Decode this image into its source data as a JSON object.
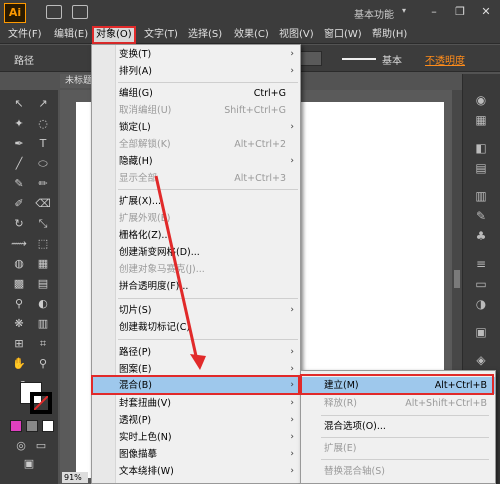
{
  "app": {
    "logo": "Ai",
    "workspace": "基本功能",
    "workspace_arrow": "▾"
  },
  "window_controls": {
    "minimize": "–",
    "restore": "❐",
    "close": "✕"
  },
  "menubar": [
    {
      "label": "文件(F)"
    },
    {
      "label": "编辑(E)"
    },
    {
      "label": "对象(O)"
    },
    {
      "label": "文字(T)"
    },
    {
      "label": "选择(S)"
    },
    {
      "label": "效果(C)"
    },
    {
      "label": "视图(V)"
    },
    {
      "label": "窗口(W)"
    },
    {
      "label": "帮助(H)"
    }
  ],
  "controlbar": {
    "path_label": "路径",
    "stroke_style": "基本",
    "opacity_link": "不透明度"
  },
  "document": {
    "tab_title": "未标题",
    "zoom": "91%"
  },
  "object_menu": {
    "items": [
      {
        "label": "变换(T)",
        "shortcut": "",
        "submenu": true,
        "disabled": false
      },
      {
        "label": "排列(A)",
        "shortcut": "",
        "submenu": true,
        "disabled": false
      },
      {
        "label": "编组(G)",
        "shortcut": "Ctrl+G",
        "submenu": false,
        "disabled": false
      },
      {
        "label": "取消编组(U)",
        "shortcut": "Shift+Ctrl+G",
        "submenu": false,
        "disabled": true
      },
      {
        "label": "锁定(L)",
        "shortcut": "",
        "submenu": true,
        "disabled": false
      },
      {
        "label": "全部解锁(K)",
        "shortcut": "Alt+Ctrl+2",
        "submenu": false,
        "disabled": true
      },
      {
        "label": "隐藏(H)",
        "shortcut": "",
        "submenu": true,
        "disabled": false
      },
      {
        "label": "显示全部",
        "shortcut": "Alt+Ctrl+3",
        "submenu": false,
        "disabled": true
      },
      {
        "label": "扩展(X)...",
        "shortcut": "",
        "submenu": false,
        "disabled": false
      },
      {
        "label": "扩展外观(E)",
        "shortcut": "",
        "submenu": false,
        "disabled": true
      },
      {
        "label": "栅格化(Z)...",
        "shortcut": "",
        "submenu": false,
        "disabled": false
      },
      {
        "label": "创建渐变网格(D)...",
        "shortcut": "",
        "submenu": false,
        "disabled": false
      },
      {
        "label": "创建对象马赛克(J)...",
        "shortcut": "",
        "submenu": false,
        "disabled": true
      },
      {
        "label": "拼合透明度(F)...",
        "shortcut": "",
        "submenu": false,
        "disabled": false
      },
      {
        "label": "切片(S)",
        "shortcut": "",
        "submenu": true,
        "disabled": false
      },
      {
        "label": "创建裁切标记(C)",
        "shortcut": "",
        "submenu": false,
        "disabled": false
      },
      {
        "label": "路径(P)",
        "shortcut": "",
        "submenu": true,
        "disabled": false
      },
      {
        "label": "图案(E)",
        "shortcut": "",
        "submenu": true,
        "disabled": false
      },
      {
        "label": "混合(B)",
        "shortcut": "",
        "submenu": true,
        "disabled": false
      },
      {
        "label": "封套扭曲(V)",
        "shortcut": "",
        "submenu": true,
        "disabled": false
      },
      {
        "label": "透视(P)",
        "shortcut": "",
        "submenu": true,
        "disabled": false
      },
      {
        "label": "实时上色(N)",
        "shortcut": "",
        "submenu": true,
        "disabled": false
      },
      {
        "label": "图像描摹",
        "shortcut": "",
        "submenu": true,
        "disabled": false
      },
      {
        "label": "文本绕排(W)",
        "shortcut": "",
        "submenu": true,
        "disabled": false
      }
    ]
  },
  "blend_submenu": {
    "items": [
      {
        "label": "建立(M)",
        "shortcut": "Alt+Ctrl+B",
        "disabled": false
      },
      {
        "label": "释放(R)",
        "shortcut": "Alt+Shift+Ctrl+B",
        "disabled": true
      },
      {
        "label": "混合选项(O)...",
        "shortcut": "",
        "disabled": false
      },
      {
        "label": "扩展(E)",
        "shortcut": "",
        "disabled": true
      },
      {
        "label": "替换混合轴(S)",
        "shortcut": "",
        "disabled": true
      }
    ]
  },
  "colors": {
    "highlight": "#9ec8ec",
    "annotation_red": "#e12a2a",
    "accent_orange": "#ff9a00"
  }
}
